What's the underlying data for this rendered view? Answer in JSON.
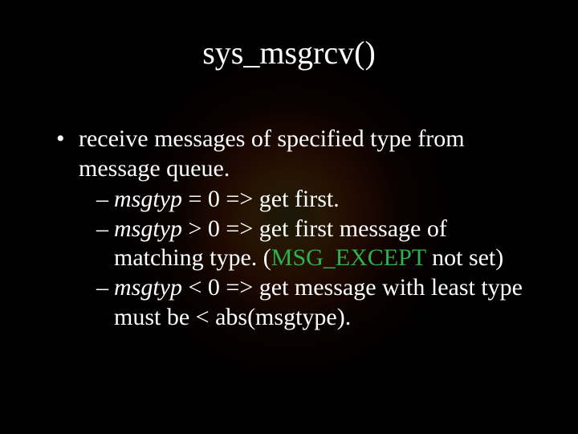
{
  "title": "sys_msgrcv()",
  "bullet": {
    "dot": "•",
    "text": "receive messages of specified type from message queue."
  },
  "sub": {
    "dash": "–",
    "a": {
      "lead": "msgtyp",
      "rest": " = 0 => get first."
    },
    "b": {
      "lead": "msgtyp",
      "mid": " > 0 => get first message of matching type. (",
      "green": "MSG_EXCEPT",
      "tail": " not set)"
    },
    "c": {
      "lead": "msgtyp",
      "rest": " < 0 => get message with least type must be < abs(msgtype)."
    }
  }
}
